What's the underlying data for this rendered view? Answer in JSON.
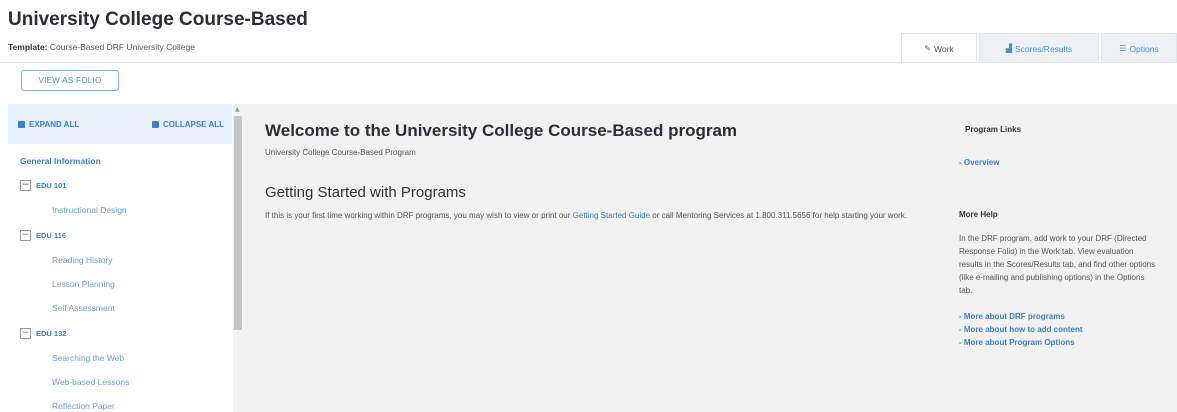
{
  "header": {
    "title": "University College Course-Based",
    "template_label": "Template:",
    "template_value": "Course-Based DRF University College"
  },
  "tabs": [
    {
      "icon": "pencil-icon",
      "glyph": "✎",
      "label": "Work",
      "active": true
    },
    {
      "icon": "chart-icon",
      "glyph": "▟",
      "label": "Scores/Results",
      "active": false
    },
    {
      "icon": "options-icon",
      "glyph": "☰",
      "label": "Options",
      "active": false
    }
  ],
  "toolbar": {
    "view_as_folio": "VIEW AS FOLIO"
  },
  "sidebar": {
    "expand_all": "EXPAND ALL",
    "collapse_all": "COLLAPSE ALL",
    "general": "General Information",
    "courses": [
      {
        "code": "EDU 101",
        "items": [
          "Instructional Design"
        ]
      },
      {
        "code": "EDU 116",
        "items": [
          "Reading History",
          "Lesson Planning",
          "Self Assessment"
        ]
      },
      {
        "code": "EDU 132",
        "items": [
          "Searching the Web",
          "Web-based Lessons",
          "Reflection Paper"
        ]
      }
    ]
  },
  "main": {
    "welcome_title": "Welcome to the University College Course-Based program",
    "welcome_subtitle": "University College Course-Based Program",
    "getting_started_title": "Getting Started with Programs",
    "gs_text_before": "If this is your first time working within DRF programs, you may wish to view or print our ",
    "gs_link": "Getting Started Guide",
    "gs_text_after": " or call Mentoring Services at 1.800.311.5656 for help starting your work."
  },
  "right": {
    "program_links_heading": "Program Links",
    "overview_link": "- Overview",
    "more_help_heading": "More Help",
    "more_help_text": "In the DRF program, add work to your DRF (Directed Response Folio) in the Work tab. View evaluation results in the Scores/Results tab, and find other options (like e-mailing and publishing options) in the Options tab.",
    "links": [
      "- More about DRF programs",
      "- More about how to add content",
      "- More about Program Options"
    ]
  },
  "colors": {
    "accent": "#3d7fc9",
    "link_light": "#6aa0d8",
    "panel_bg": "#f1f1f1",
    "sidebar_header_bg": "#e6eff8"
  }
}
